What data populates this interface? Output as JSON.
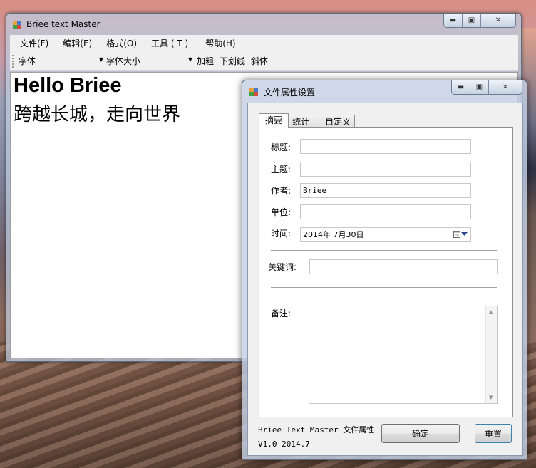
{
  "main_window": {
    "title": "Briee text Master",
    "menu": [
      "文件(F)",
      "编辑(E)",
      "格式(O)",
      "工具 ( T )",
      "帮助(H)"
    ],
    "toolbar": {
      "font_combo": "字体",
      "size_combo": "字体大小",
      "bold": "加粗",
      "underline": "下划线",
      "italic": "斜体"
    },
    "editor": {
      "line1": "Hello Briee",
      "line2": "跨越长城，走向世界"
    }
  },
  "dialog": {
    "title": "文件属性设置",
    "tabs": [
      "摘要",
      "统计",
      "自定义"
    ],
    "fields": {
      "title_label": "标题:",
      "title_value": "",
      "subject_label": "主题:",
      "subject_value": "",
      "author_label": "作者:",
      "author_value": "Briee",
      "company_label": "单位:",
      "company_value": "",
      "date_label": "时间:",
      "date_value": "2014年  7月30日",
      "keywords_label": "关键词:",
      "keywords_value": "",
      "notes_label": "备注:",
      "notes_value": ""
    },
    "footer": {
      "line1": "Briee Text Master 文件属性",
      "line2": "V1.0 2014.7",
      "ok_button": "确定",
      "reset_button": "重置"
    }
  }
}
